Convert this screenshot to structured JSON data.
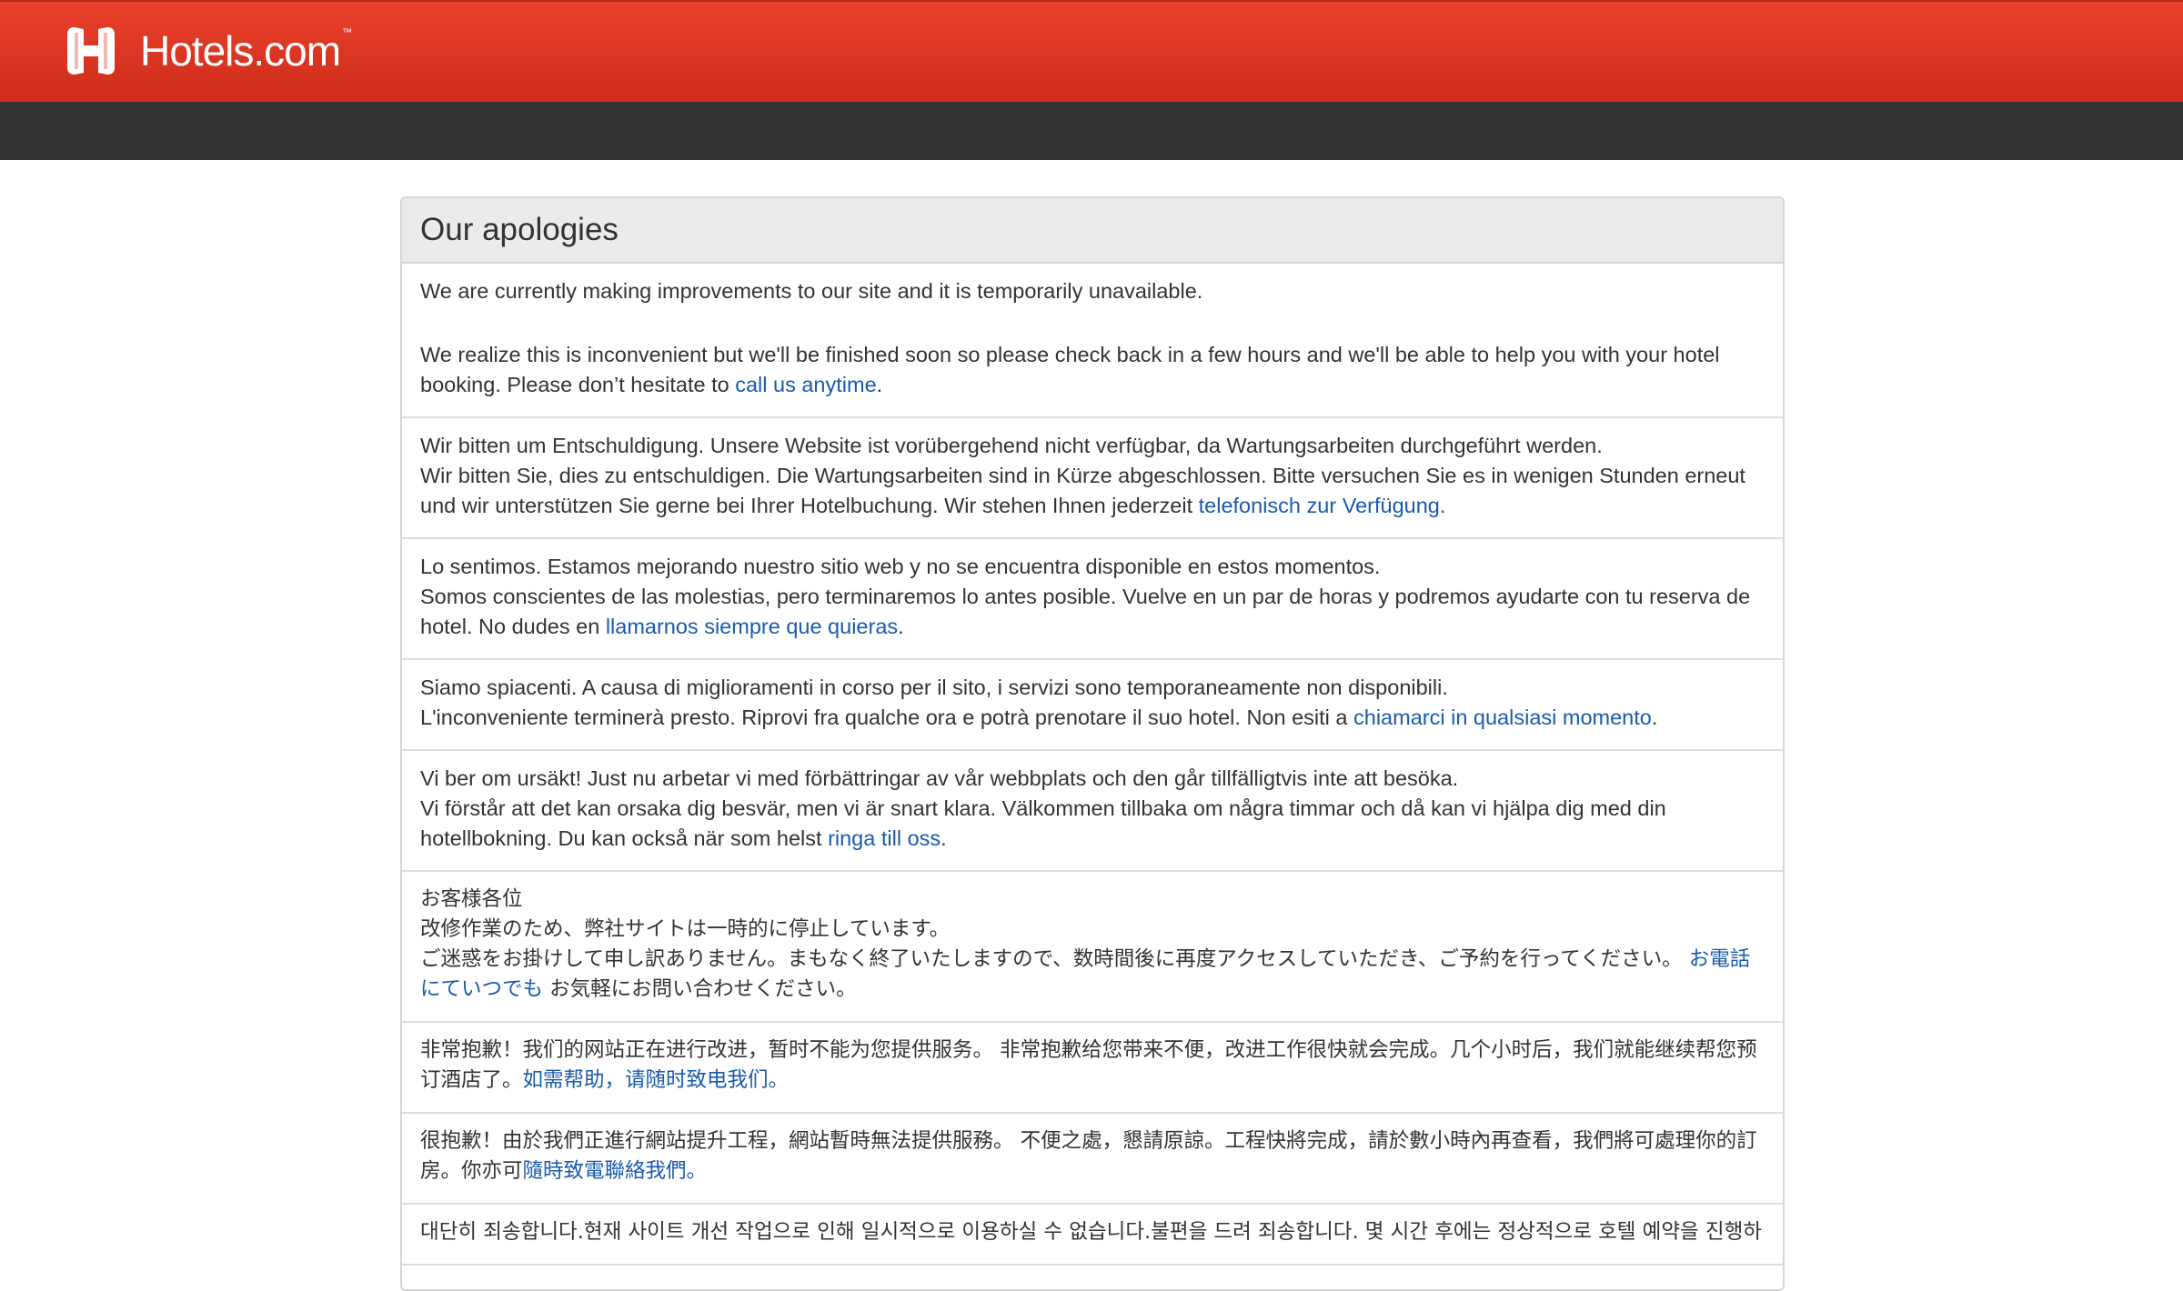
{
  "brand": {
    "name": "Hotels.com",
    "tm": "™"
  },
  "colors": {
    "header_red": "#d9341f",
    "dark_bar": "#333333",
    "link": "#1a5aab"
  },
  "panel": {
    "title": "Our apologies"
  },
  "messages": {
    "en": {
      "line1": "We are currently making improvements to our site and it is temporarily unavailable.",
      "line2_pre": "We realize this is inconvenient but we'll be finished soon so please check back in a few hours and we'll be able to help you with your hotel booking. Please don’t hesitate to ",
      "link": "call us anytime",
      "post": "."
    },
    "de": {
      "line1": "Wir bitten um Entschuldigung. Unsere Website ist vorübergehend nicht verfügbar, da Wartungsarbeiten durchgeführt werden.",
      "line2_pre": "Wir bitten Sie, dies zu entschuldigen. Die Wartungsarbeiten sind in Kürze abgeschlossen. Bitte versuchen Sie es in wenigen Stunden erneut und wir unterstützen Sie gerne bei Ihrer Hotelbuchung. Wir stehen Ihnen jederzeit ",
      "link": "telefonisch zur Verfügung.",
      "post": ""
    },
    "es": {
      "line1": "Lo sentimos. Estamos mejorando nuestro sitio web y no se encuentra disponible en estos momentos.",
      "line2_pre": "Somos conscientes de las molestias, pero terminaremos lo antes posible. Vuelve en un par de horas y podremos ayudarte con tu reserva de hotel. No dudes en ",
      "link": "llamarnos siempre que quieras",
      "post": "."
    },
    "it": {
      "line1": "Siamo spiacenti. A causa di miglioramenti in corso per il sito, i servizi sono temporaneamente non disponibili.",
      "line2_pre": "L'inconveniente terminerà presto. Riprovi fra qualche ora e potrà prenotare il suo hotel. Non esiti a ",
      "link": "chiamarci in qualsiasi momento",
      "post": "."
    },
    "sv": {
      "line1": "Vi ber om ursäkt! Just nu arbetar vi med förbättringar av vår webbplats och den går tillfälligtvis inte att besöka.",
      "line2_pre": "Vi förstår att det kan orsaka dig besvär, men vi är snart klara. Välkommen tillbaka om några timmar och då kan vi hjälpa dig med din hotellbokning. Du kan också när som helst ",
      "link": "ringa till oss",
      "post": "."
    },
    "ja": {
      "line1": "お客様各位",
      "line2": "改修作業のため、弊社サイトは一時的に停止しています。",
      "line3_pre": "ご迷惑をお掛けして申し訳ありません。まもなく終了いたしますので、数時間後に再度アクセスしていただき、ご予約を行ってください。 ",
      "link": "お電話にていつでも",
      "post": " お気軽にお問い合わせください。"
    },
    "zh_cn": {
      "pre": "非常抱歉！我们的网站正在进行改进，暂时不能为您提供服务。 非常抱歉给您带来不便，改进工作很快就会完成。几个小时后，我们就能继续帮您预订酒店了。",
      "link": "如需帮助，请随时致电我们。",
      "post": ""
    },
    "zh_tw": {
      "pre": "很抱歉！由於我們正進行網站提升工程，網站暫時無法提供服務。 不便之處，懇請原諒。工程快將完成，請於數小時內再查看，我們將可處理你的訂房。你亦可",
      "link": "隨時致電聯絡我們。",
      "post": ""
    },
    "ko": {
      "pre": "대단히 죄송합니다.현재 사이트 개선 작업으로 인해 일시적으로 이용하실 수 없습니다.불편을 드려 죄송합니다. 몇 시간 후에는 정상적으로 호텔 예약을 진행하"
    }
  }
}
